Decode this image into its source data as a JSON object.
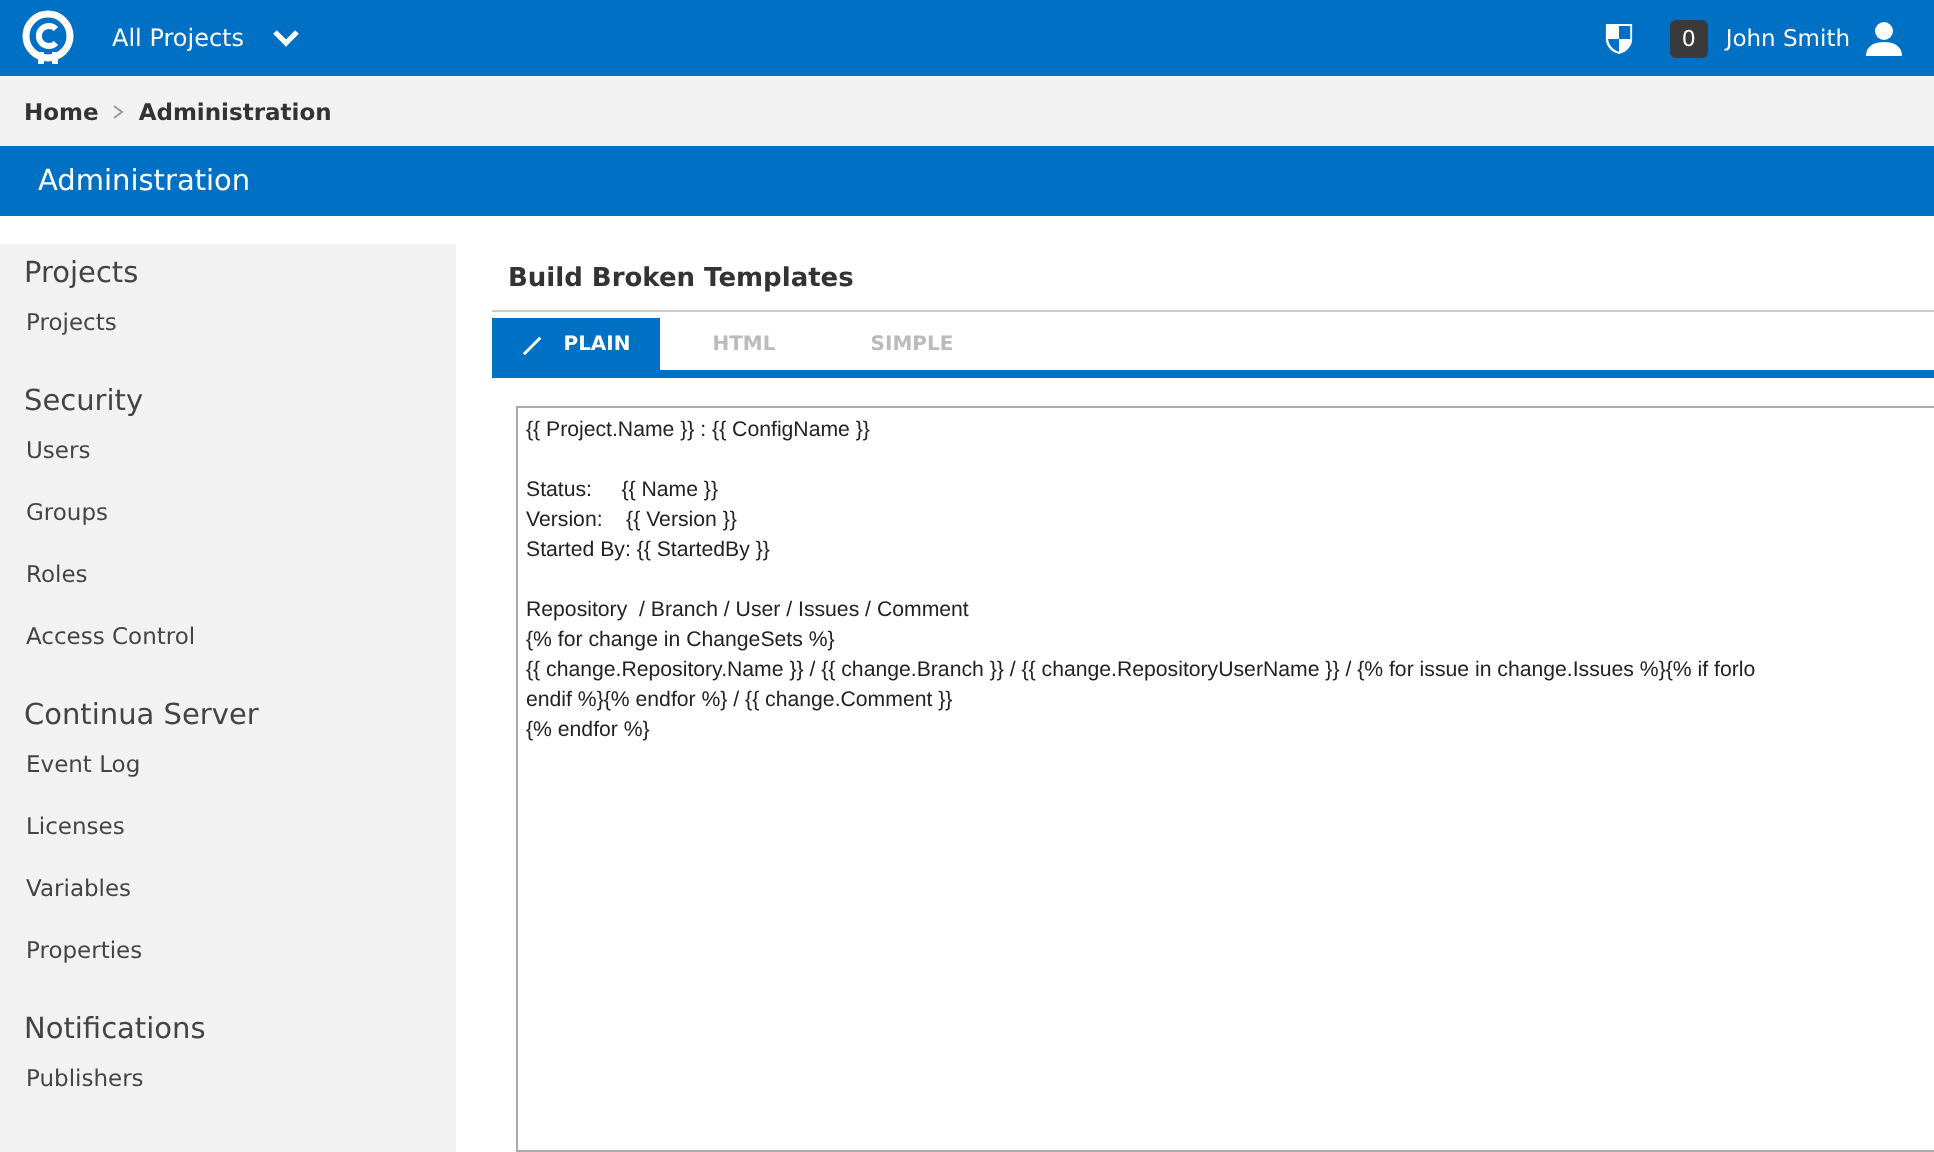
{
  "topbar": {
    "project_selector": "All Projects",
    "notification_count": "0",
    "user_name": "John Smith"
  },
  "breadcrumb": [
    "Home",
    "Administration"
  ],
  "page_title": "Administration",
  "sidebar": [
    {
      "heading": "Projects",
      "items": [
        "Projects"
      ]
    },
    {
      "heading": "Security",
      "items": [
        "Users",
        "Groups",
        "Roles",
        "Access Control"
      ]
    },
    {
      "heading": "Continua Server",
      "items": [
        "Event Log",
        "Licenses",
        "Variables",
        "Properties"
      ]
    },
    {
      "heading": "Notifications",
      "items": [
        "Publishers"
      ]
    }
  ],
  "section_title": "Build Broken Templates",
  "tabs": [
    {
      "label": "PLAIN",
      "selected": true
    },
    {
      "label": "HTML",
      "selected": false
    },
    {
      "label": "SIMPLE",
      "selected": false
    }
  ],
  "template_paragraphs": [
    [
      "{{ Project.Name }} : {{ ConfigName }}"
    ],
    [
      "Status:     {{ Name }}",
      "Version:    {{ Version }}",
      "Started By: {{ StartedBy }}"
    ],
    [
      "Repository  / Branch / User / Issues / Comment",
      "{% for change in ChangeSets %}",
      "{{ change.Repository.Name }} / {{ change.Branch }} / {{ change.RepositoryUserName }} / {% for issue in change.Issues %}{% if forlo",
      "endif %}{% endfor %} / {{ change.Comment }}",
      "{% endfor %}"
    ]
  ]
}
